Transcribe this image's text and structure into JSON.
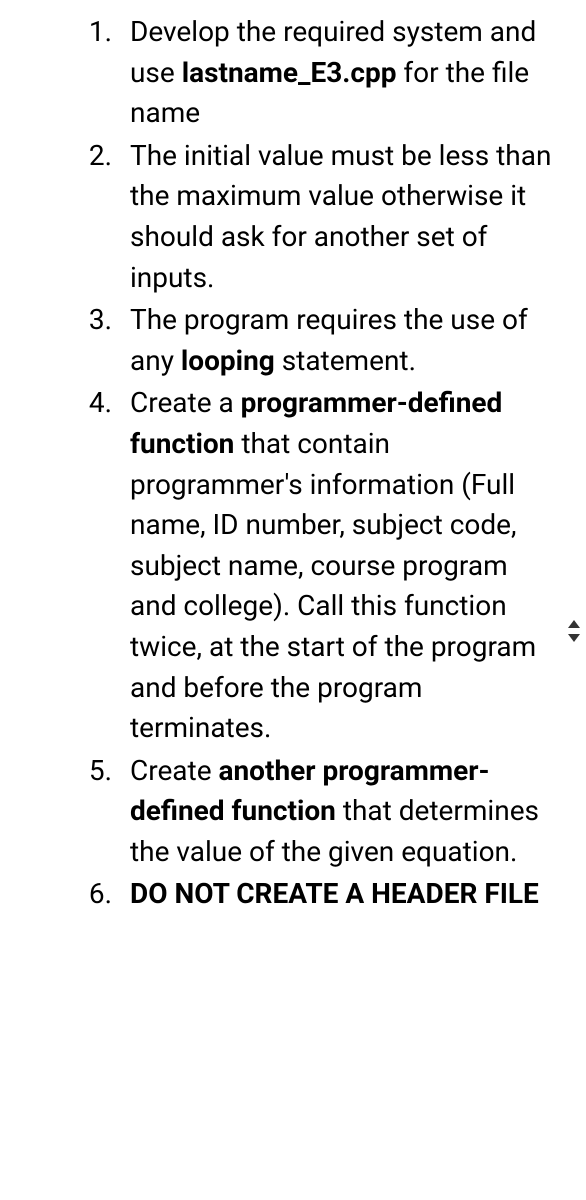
{
  "list": {
    "items": [
      {
        "num": "1.",
        "segments": [
          {
            "text": "Develop the required system and use ",
            "bold": false
          },
          {
            "text": "lastname_E3.cpp",
            "bold": true
          },
          {
            "text": " for the file name",
            "bold": false
          }
        ]
      },
      {
        "num": "2.",
        "segments": [
          {
            "text": "The initial value must be less than the maximum value otherwise it should ask for another set of inputs.",
            "bold": false
          }
        ]
      },
      {
        "num": "3.",
        "segments": [
          {
            "text": "The program requires the use of any ",
            "bold": false
          },
          {
            "text": "looping",
            "bold": true
          },
          {
            "text": " statement.",
            "bold": false
          }
        ]
      },
      {
        "num": "4.",
        "segments": [
          {
            "text": "Create a ",
            "bold": false
          },
          {
            "text": "programmer-defined function",
            "bold": true
          },
          {
            "text": " that contain programmer's information (Full name, ID number, subject code, subject name, course program and college). Call this function twice, at the start of the program and before the program terminates.",
            "bold": false
          }
        ]
      },
      {
        "num": "5.",
        "segments": [
          {
            "text": "Create ",
            "bold": false
          },
          {
            "text": "another programmer-defined function",
            "bold": true
          },
          {
            "text": " that determines the value of the given equation.",
            "bold": false
          }
        ]
      },
      {
        "num": "6.",
        "segments": [
          {
            "text": "DO NOT CREATE A HEADER FILE",
            "bold": true
          }
        ]
      }
    ]
  }
}
